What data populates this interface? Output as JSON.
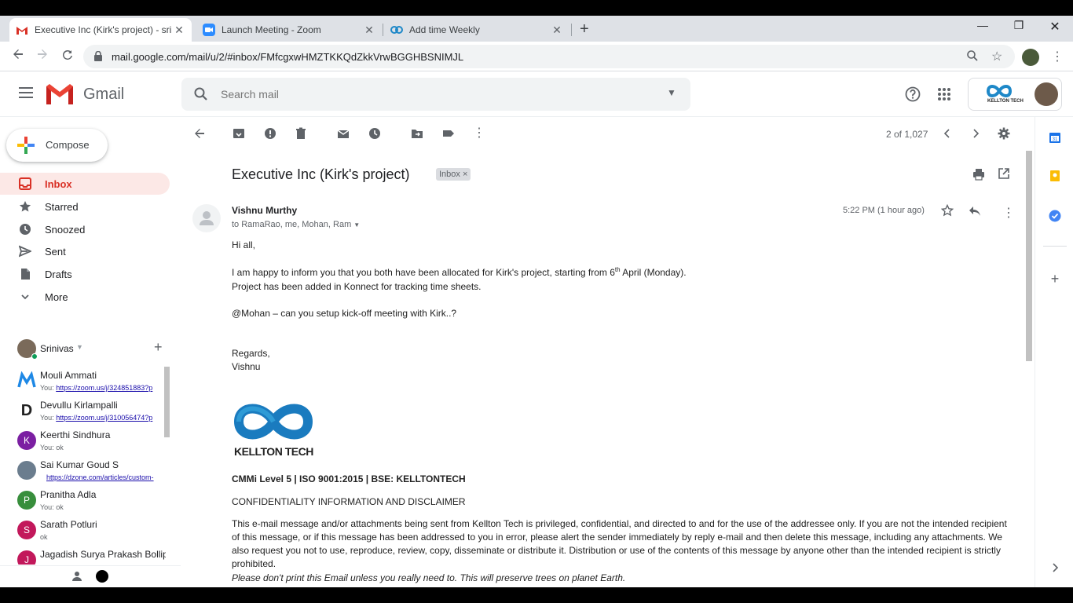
{
  "browser": {
    "tabs": [
      {
        "title": "Executive Inc (Kirk's project) - sri",
        "active": true,
        "favicon": "gmail-icon"
      },
      {
        "title": "Launch Meeting - Zoom",
        "active": false,
        "favicon": "zoom-icon"
      },
      {
        "title": "Add time Weekly",
        "active": false,
        "favicon": "konnect-icon"
      }
    ],
    "url": "mail.google.com/mail/u/2/#inbox/FMfcgxwHMZTKKQdZkkVrwBGGHBSNIMJL"
  },
  "gmail": {
    "logo_text": "Gmail",
    "search_placeholder": "Search mail",
    "brand_label": "KELLTON TECH",
    "compose_label": "Compose",
    "nav": [
      {
        "label": "Inbox",
        "icon": "inbox-icon",
        "active": true
      },
      {
        "label": "Starred",
        "icon": "star-icon",
        "active": false
      },
      {
        "label": "Snoozed",
        "icon": "clock-icon",
        "active": false
      },
      {
        "label": "Sent",
        "icon": "send-icon",
        "active": false
      },
      {
        "label": "Drafts",
        "icon": "draft-icon",
        "active": false
      },
      {
        "label": "More",
        "icon": "chevron-down-icon",
        "active": false
      }
    ],
    "hangouts_user": "Srinivas",
    "chats": [
      {
        "name": "Mouli Ammati",
        "prefix": "You: ",
        "message": "https://zoom.us/j/324851883?p",
        "link": true,
        "initial": "M",
        "color": "#ffffff"
      },
      {
        "name": "Devullu Kirlampalli",
        "prefix": "You: ",
        "message": "https://zoom.us/j/310056474?p",
        "link": true,
        "initial": "D",
        "color": "#ffffff"
      },
      {
        "name": "Keerthi Sindhura",
        "prefix": "You: ",
        "message": "ok",
        "link": false,
        "initial": "K",
        "color": "#7b1fa2"
      },
      {
        "name": "Sai Kumar Goud S",
        "prefix": "",
        "message": "https://dzone.com/articles/custom-",
        "link": true,
        "initial": "",
        "color": "#6b7d8e"
      },
      {
        "name": "Pranitha Adla",
        "prefix": "You: ",
        "message": "ok",
        "link": false,
        "initial": "P",
        "color": "#388e3c"
      },
      {
        "name": "Sarath Potluri",
        "prefix": "",
        "message": "ok",
        "link": false,
        "initial": "S",
        "color": "#c2185b"
      },
      {
        "name": "Jagadish Surya Prakash Bollip",
        "prefix": "",
        "message": "",
        "link": false,
        "initial": "J",
        "color": "#c2185b"
      }
    ],
    "pagination": "2 of 1,027"
  },
  "email": {
    "subject": "Executive Inc (Kirk's project)",
    "label_chip": "Inbox",
    "sender": "Vishnu Murthy",
    "recipients": "to RamaRao, me, Mohan, Ram",
    "time": "5:22 PM (1 hour ago)",
    "greeting": "Hi all,",
    "line1_a": "I am happy to inform you that you both have been allocated for Kirk's project, starting from 6",
    "line1_sup": "th",
    "line1_b": " April (Monday).",
    "line2": "Project has been added in Konnect for tracking time sheets.",
    "line3": "@Mohan – can you setup kick-off meeting with Kirk..?",
    "regards": "Regards,",
    "signature": "Vishnu",
    "logo_text": "KELLTON TECH",
    "cmmi": "CMMi Level 5 | ISO 9001:2015 | BSE: KELLTONTECH",
    "conf_title": "CONFIDENTIALITY INFORMATION AND DISCLAIMER",
    "disclaimer": "This e-mail message and/or attachments being sent from Kellton Tech is privileged, confidential, and directed to and for the use of the addressee only. If you are not the intended recipient of this message, or if this message has been addressed to you in error, please alert the sender immediately by reply e-mail and then delete this message, including any attachments. We also request you not to use, reproduce, review, copy, disseminate or distribute it. Distribution or use of the contents of this message by anyone other than the intended recipient is strictly prohibited.",
    "footer_note": "Please don't print this Email unless you really need to. This will preserve trees on planet Earth."
  },
  "colors": {
    "accent_red": "#d93025",
    "inbox_active_bg": "#fce8e6",
    "link": "#1a0dab"
  }
}
